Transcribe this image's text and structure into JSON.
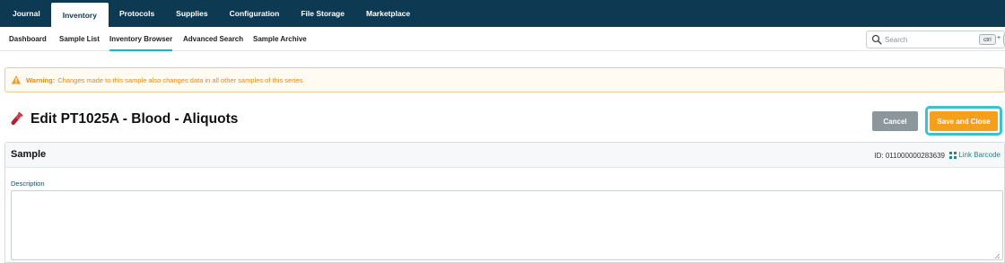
{
  "topnav": {
    "tabs": [
      {
        "label": "Journal",
        "active": false
      },
      {
        "label": "Inventory",
        "active": true
      },
      {
        "label": "Protocols",
        "active": false
      },
      {
        "label": "Supplies",
        "active": false
      },
      {
        "label": "Configuration",
        "active": false
      },
      {
        "label": "File Storage",
        "active": false
      },
      {
        "label": "Marketplace",
        "active": false
      }
    ]
  },
  "subnav": {
    "items": [
      {
        "label": "Dashboard"
      },
      {
        "label": "Sample List"
      },
      {
        "label": "Inventory Browser",
        "active": true
      },
      {
        "label": "Advanced Search"
      },
      {
        "label": "Sample Archive"
      }
    ]
  },
  "search": {
    "placeholder": "Search",
    "shortcut_key": "ctrl",
    "shortcut_plus": "+"
  },
  "warning": {
    "label": "Warning:",
    "text": "Changes made to this sample also changes data in all other samples of this series.",
    "icon": "warning-triangle-icon"
  },
  "page": {
    "title": "Edit PT1025A - Blood - Aliquots",
    "icon": "test-tube-icon"
  },
  "actions": {
    "cancel_label": "Cancel",
    "save_label": "Save and Close"
  },
  "sample_panel": {
    "title": "Sample",
    "id_text": "ID: 011000000283639",
    "link_barcode_label": "Link Barcode",
    "description_label": "Description",
    "description_value": ""
  },
  "colors": {
    "nav_bg": "#0d3a52",
    "accent": "#14b8c7",
    "warning": "#e48a10",
    "save": "#f5a01d",
    "cancel": "#8c979d"
  }
}
